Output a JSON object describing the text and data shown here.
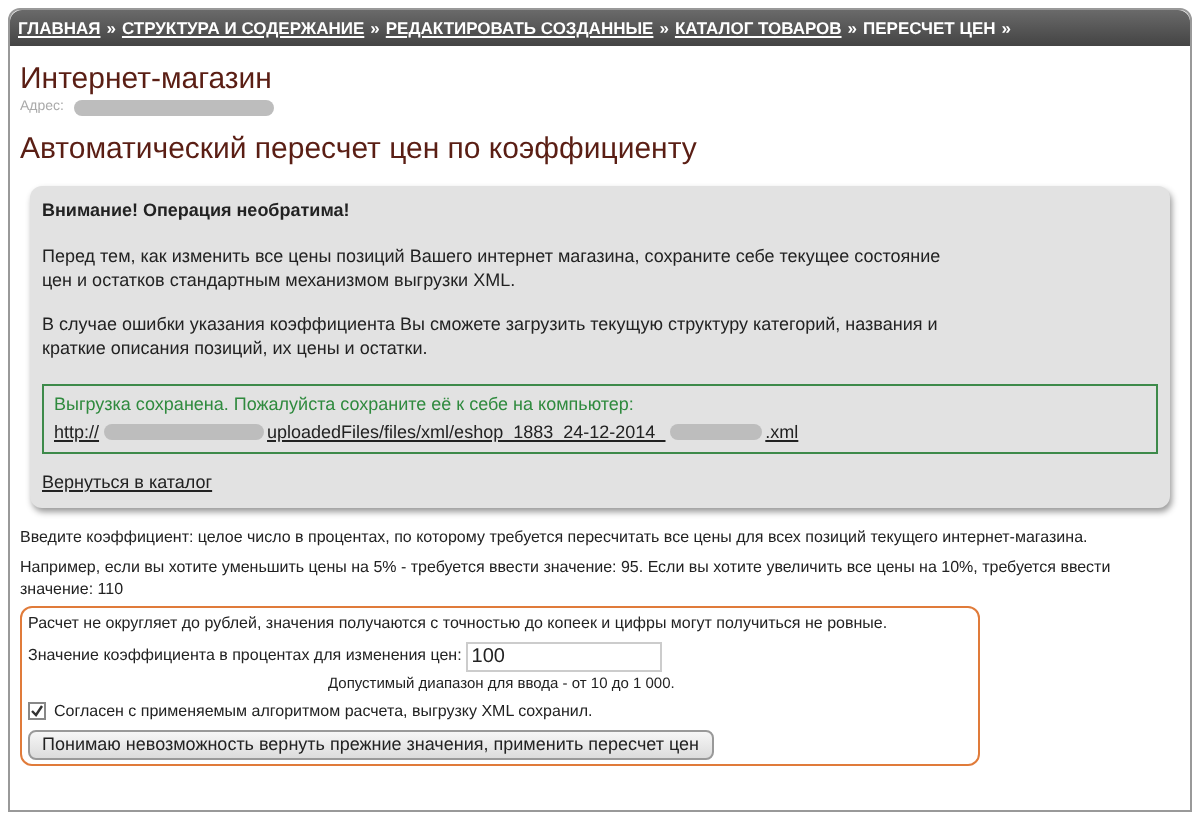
{
  "breadcrumbs": [
    {
      "label": "ГЛАВНАЯ",
      "link": true
    },
    {
      "label": "СТРУКТУРА И СОДЕРЖАНИЕ",
      "link": true
    },
    {
      "label": "РЕДАКТИРОВАТЬ СОЗДАННЫЕ",
      "link": true
    },
    {
      "label": "КАТАЛОГ ТОВАРОВ",
      "link": true
    },
    {
      "label": "ПЕРЕСЧЕТ ЦЕН",
      "link": false
    }
  ],
  "separator": "»",
  "shop_title": "Интернет-магазин",
  "address_label": "Адрес:",
  "page_title": "Автоматический пересчет цен по коэффициенту",
  "warning": {
    "title": "Внимание! Операция необратима!",
    "paragraphs": [
      "Перед тем, как изменить все цены позиций Вашего интернет магазина, сохраните себе текущее состояние цен и остатков стандартным механизмом выгрузки XML.",
      "В случае ошибки указания коэффициента Вы сможете загрузить текущую структуру категорий, названия и краткие описания позиций, их цены и остатки."
    ],
    "saved_message": "Выгрузка сохранена. Пожалуйста сохраните её к себе на компьютер:",
    "file_link": {
      "start": "http://",
      "middle": "uploadedFiles/files/xml/eshop_1883_24-12-2014_",
      "end": ".xml"
    },
    "back_link": "Вернуться в каталог"
  },
  "instructions": [
    "Введите коэффициент: целое число в процентах, по которому требуется пересчитать все цены для всех позиций текущего интернет-магазина.",
    "Например, если вы хотите уменьшить цены на 5% - требуется ввести значение: 95. Если вы хотите увеличить все цены на 10%, требуется ввести значение: 110"
  ],
  "form": {
    "note": "Расчет не округляет до рублей, значения получаются с точностью до копеек и цифры могут получиться не ровные.",
    "field_label": "Значение коэффициента в процентах для изменения цен:",
    "field_value": "100",
    "range_hint": "Допустимый диапазон для ввода - от 10 до 1 000.",
    "agree": {
      "label": "Согласен с применяемым алгоритмом расчета, выгрузку XML сохранил.",
      "checked": true
    },
    "submit": "Понимаю невозможность вернуть прежние значения, применить пересчет цен"
  }
}
